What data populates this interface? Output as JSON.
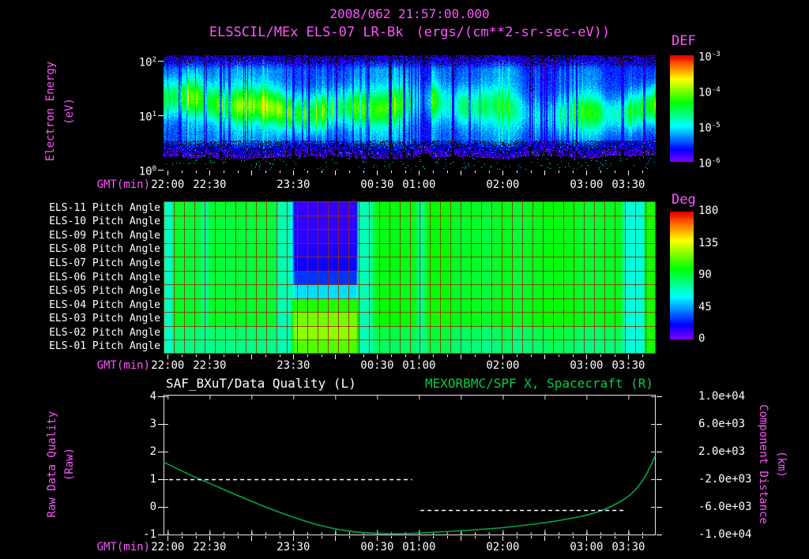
{
  "header": {
    "title": "2008/062 21:57:00.000",
    "instrument": "ELSSCIL/MEx ELS-07 LR-Bk",
    "units": "(ergs/(cm**2-sr-sec-eV))"
  },
  "time_axis": {
    "label": "GMT(min)",
    "total_minutes": 352,
    "minor_tick_step": 10,
    "minor_start": 3,
    "ticks": [
      {
        "label": "22:00",
        "minute": 3
      },
      {
        "label": "22:30",
        "minute": 33
      },
      {
        "label": "23:30",
        "minute": 93
      },
      {
        "label": "00:30",
        "minute": 153
      },
      {
        "label": "01:00",
        "minute": 183
      },
      {
        "label": "02:00",
        "minute": 243
      },
      {
        "label": "03:00",
        "minute": 303
      },
      {
        "label": "03:30",
        "minute": 333
      }
    ],
    "major_tick_minutes": [
      3,
      33,
      63,
      93,
      123,
      153,
      183,
      213,
      243,
      273,
      303,
      333
    ]
  },
  "spectrogram": {
    "ylabel_line1": "Electron Energy",
    "ylabel_line2": "(eV)",
    "yticks": [
      {
        "base": "10",
        "exp": "2"
      },
      {
        "base": "10",
        "exp": "1"
      },
      {
        "base": "10",
        "exp": "0"
      }
    ],
    "colorbar": {
      "title": "DEF",
      "ticks": [
        {
          "base": "10",
          "exp": "-3"
        },
        {
          "base": "10",
          "exp": "-4"
        },
        {
          "base": "10",
          "exp": "-5"
        },
        {
          "base": "10",
          "exp": "-6"
        }
      ]
    }
  },
  "pitch": {
    "row_labels": [
      "ELS-11 Pitch Angle",
      "ELS-10 Pitch Angle",
      "ELS-09 Pitch Angle",
      "ELS-08 Pitch Angle",
      "ELS-07 Pitch Angle",
      "ELS-06 Pitch Angle",
      "ELS-05 Pitch Angle",
      "ELS-04 Pitch Angle",
      "ELS-03 Pitch Angle",
      "ELS-02 Pitch Angle",
      "ELS-01 Pitch Angle"
    ],
    "colorbar": {
      "title": "Deg",
      "ticks": [
        "180",
        "135",
        "90",
        "45",
        "0"
      ]
    }
  },
  "lineplot": {
    "title_left": "SAF_BXuT/Data Quality (L)",
    "title_right": "MEXORBMC/SPF X, Spacecraft (R)",
    "ylabel_left_line1": "Raw Data Quality",
    "ylabel_left_line2": "(Raw)",
    "ylabel_right_line1": "Component Distance",
    "ylabel_right_line2": "(km)",
    "yticks_left": [
      "4",
      "3",
      "2",
      "1",
      "0",
      "-1"
    ],
    "yticks_right": [
      "1.0e+04",
      "6.0e+03",
      "2.0e+03",
      "-2.0e+03",
      "-6.0e+03",
      "-1.0e+04"
    ]
  },
  "colors": {
    "magenta": "#ff55ff",
    "white": "#ffffff",
    "green_text": "#00d044",
    "curve_green": "#00a845",
    "grid_red": "rgba(150,45,0,0.85)"
  },
  "chart_data": [
    {
      "type": "heatmap",
      "panel": "electron_energy_spectrogram",
      "title": "ELSSCIL/MEx ELS-07 LR-Bk",
      "units": "ergs/(cm**2-sr-sec-eV)",
      "colorbar_title": "DEF",
      "xlabel": "GMT(min)",
      "x_ticks": [
        "22:00",
        "22:30",
        "23:30",
        "00:30",
        "01:00",
        "02:00",
        "03:00",
        "03:30"
      ],
      "ylabel": "Electron Energy (eV)",
      "yscale": "log",
      "ylim": [
        1,
        140
      ],
      "zscale": "log",
      "zlim": [
        1e-06,
        0.001
      ],
      "summary": "Blue ~1e-5 background with persistent cyan-green flux band near 8-40 eV; speckled near-black flux below ~3.5 eV and above ~80 eV; vertical dark dropout near 01:05; bright green low-energy enhancement after 03:30.",
      "gen": {
        "seed": 1234,
        "background_z": 4e-06,
        "band_peak_z": 3.2e-05,
        "band_center_ev": 15,
        "low_cutoff_ev": 3.5
      }
    },
    {
      "type": "heatmap",
      "panel": "pitch_angle",
      "colorbar_title": "Deg",
      "zlim": [
        0,
        180
      ],
      "rows": [
        "ELS-11",
        "ELS-10",
        "ELS-09",
        "ELS-08",
        "ELS-07",
        "ELS-06",
        "ELS-05",
        "ELS-04",
        "ELS-03",
        "ELS-02",
        "ELS-01"
      ],
      "base_deg": 95,
      "row_offsets": [
        1,
        0,
        -1,
        1,
        0,
        -1,
        0,
        2,
        3,
        -8,
        -12
      ],
      "bands": [
        {
          "t0": 0.0,
          "t1": 0.018,
          "deg": 68
        },
        {
          "t0": 0.077,
          "t1": 0.09,
          "deg": 76
        },
        {
          "t0": 0.229,
          "t1": 0.262,
          "deg": 72
        },
        {
          "t0": 0.262,
          "t1": 0.396,
          "deg_by_row": [
            12,
            12,
            13,
            15,
            18,
            28,
            55,
            105,
            118,
            122,
            112
          ]
        },
        {
          "t0": 0.396,
          "t1": 0.425,
          "deg": 72
        },
        {
          "t0": 0.515,
          "t1": 0.532,
          "deg": 78
        },
        {
          "t0": 0.934,
          "t1": 0.98,
          "deg": 66
        },
        {
          "t0": 0.98,
          "t1": 1.0,
          "deg": 103
        }
      ],
      "grid_cols": 48
    },
    {
      "type": "line",
      "panel": "quality_and_spacecraft_position",
      "title_left": "SAF_BXuT/Data Quality (L)",
      "title_right": "MEXORBMC/SPF X, Spacecraft (R)",
      "left_axis": {
        "label": "Raw Data Quality (Raw)",
        "range": [
          -1,
          4
        ]
      },
      "right_axis": {
        "label": "Component Distance (km)",
        "range": [
          -10000,
          10000
        ]
      },
      "series": [
        {
          "name": "MEXORBMC/SPF X Spacecraft",
          "axis": "right",
          "color": "#00a845",
          "t_min": [
            0,
            17,
            33,
            50,
            70,
            93,
            110,
            125,
            140,
            155,
            170,
            185,
            205,
            225,
            245,
            265,
            285,
            305,
            320,
            335,
            345,
            352
          ],
          "km": [
            500,
            -1200,
            -2600,
            -4100,
            -5800,
            -7500,
            -8600,
            -9300,
            -9700,
            -9880,
            -9890,
            -9780,
            -9550,
            -9320,
            -8980,
            -8520,
            -7950,
            -7150,
            -6100,
            -4300,
            -1800,
            1300
          ]
        },
        {
          "name": "SAF_BXuT Data Quality",
          "axis": "left",
          "color": "#ffffff",
          "dashed": true,
          "segments": [
            {
              "t0": 4,
              "t1": 178,
              "value": 1
            },
            {
              "t0": 184,
              "t1": 330,
              "value": -0.1
            }
          ]
        }
      ]
    }
  ]
}
